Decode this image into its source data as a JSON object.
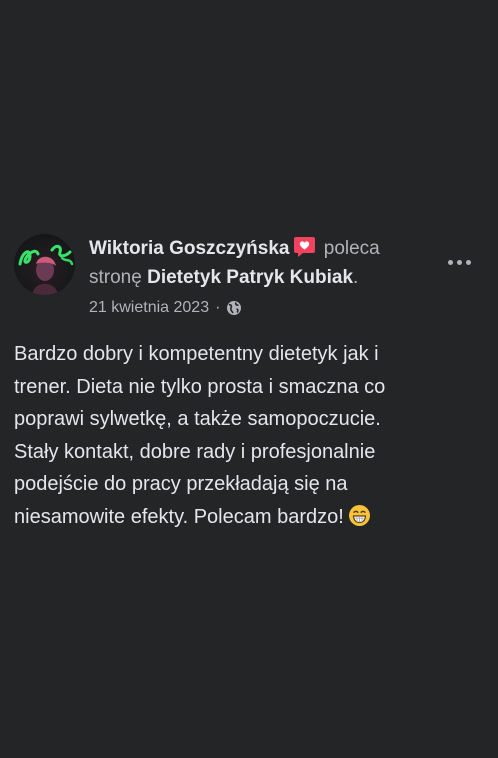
{
  "post": {
    "author": "Wiktoria Goszczyńska",
    "action_before": " poleca",
    "action_after": "stronę ",
    "page_name": "Dietetyk Patryk Kubiak",
    "page_suffix": ".",
    "date": "21 kwietnia 2023",
    "separator": "·",
    "audience_icon": "globe-icon",
    "recommendation_icon": "heart-bubble-icon",
    "text": "Bardzo dobry i kompetentny dietetyk jak i\ntrener. Dieta nie tylko prosta i smaczna co\npoprawi sylwetkę, a także samopoczucie.\nStały kontakt, dobre rady i profesjonalnie\npodejście do pracy przekładają się na\nniesamowite efekty. Polecam bardzo!",
    "emoji": "grinning-face-icon"
  },
  "colors": {
    "background": "#242526",
    "primary_text": "#e4e6eb",
    "secondary_text": "#b0b3b8",
    "recommend_red": "#f3425f"
  }
}
